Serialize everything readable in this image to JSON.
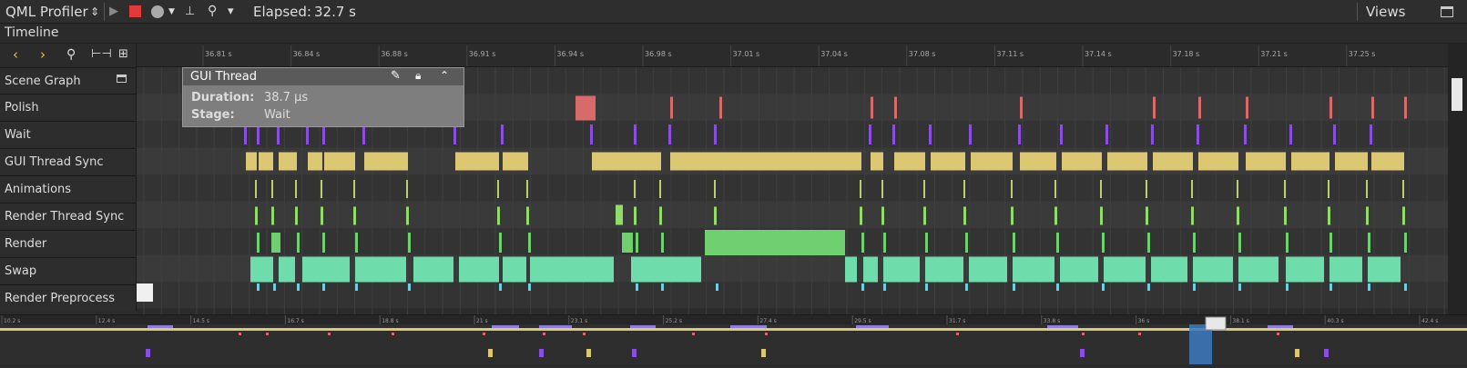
{
  "toolbar": {
    "title": "QML Profiler",
    "title_dropdown_icon": "updown-arrows-icon",
    "elapsed_label": "Elapsed:",
    "elapsed_value": "32.7 s",
    "views_label": "Views",
    "record_color": "#e03a3a",
    "icons": [
      "cursor-icon",
      "record-icon",
      "capture-circle-icon",
      "dropdown-arrow-icon",
      "ruler-icon",
      "search-icon",
      "filter-icon",
      "detach-icon"
    ]
  },
  "timeline": {
    "title": "Timeline",
    "nav_icons": [
      "prev-icon",
      "next-icon",
      "zoom-icon",
      "range-icon",
      "jump-icon"
    ],
    "ticks": [
      "36.81 s",
      "36.84 s",
      "36.88 s",
      "36.91 s",
      "36.94 s",
      "36.98 s",
      "37.01 s",
      "37.04 s",
      "37.08 s",
      "37.11 s",
      "37.14 s",
      "37.18 s",
      "37.21 s",
      "37.25 s"
    ],
    "rows": [
      {
        "label": "Scene Graph",
        "expand_icon": "collapse-icon"
      },
      {
        "label": "Polish"
      },
      {
        "label": "Wait"
      },
      {
        "label": "GUI Thread Sync"
      },
      {
        "label": "Animations"
      },
      {
        "label": "Render Thread Sync"
      },
      {
        "label": "Render"
      },
      {
        "label": "Swap"
      },
      {
        "label": "Render Preprocess"
      }
    ],
    "colors": {
      "polish": "#d86a6a",
      "wait": "#8a4ee0",
      "gui_sync": "#dcc872",
      "animations": "#b8d070",
      "render_sync": "#8fdc6a",
      "render": "#6fd070",
      "swap": "#6fdcac",
      "preprocess": "#6fcfe0"
    }
  },
  "tooltip": {
    "title": "GUI Thread",
    "icons": [
      "edit-icon",
      "lock-icon",
      "collapse-up-icon"
    ],
    "fields": [
      {
        "key": "Duration:",
        "value": "38.7 µs"
      },
      {
        "key": "Stage:",
        "value": "Wait"
      }
    ]
  },
  "overview": {
    "ticks": [
      "10.2 s",
      "12.4 s",
      "14.5 s",
      "16.7 s",
      "18.8 s",
      "21 s",
      "23.1 s",
      "25.2 s",
      "27.4 s",
      "29.5 s",
      "31.7 s",
      "33.8 s",
      "36 s",
      "38.1 s",
      "40.3 s",
      "42.4 s"
    ]
  }
}
